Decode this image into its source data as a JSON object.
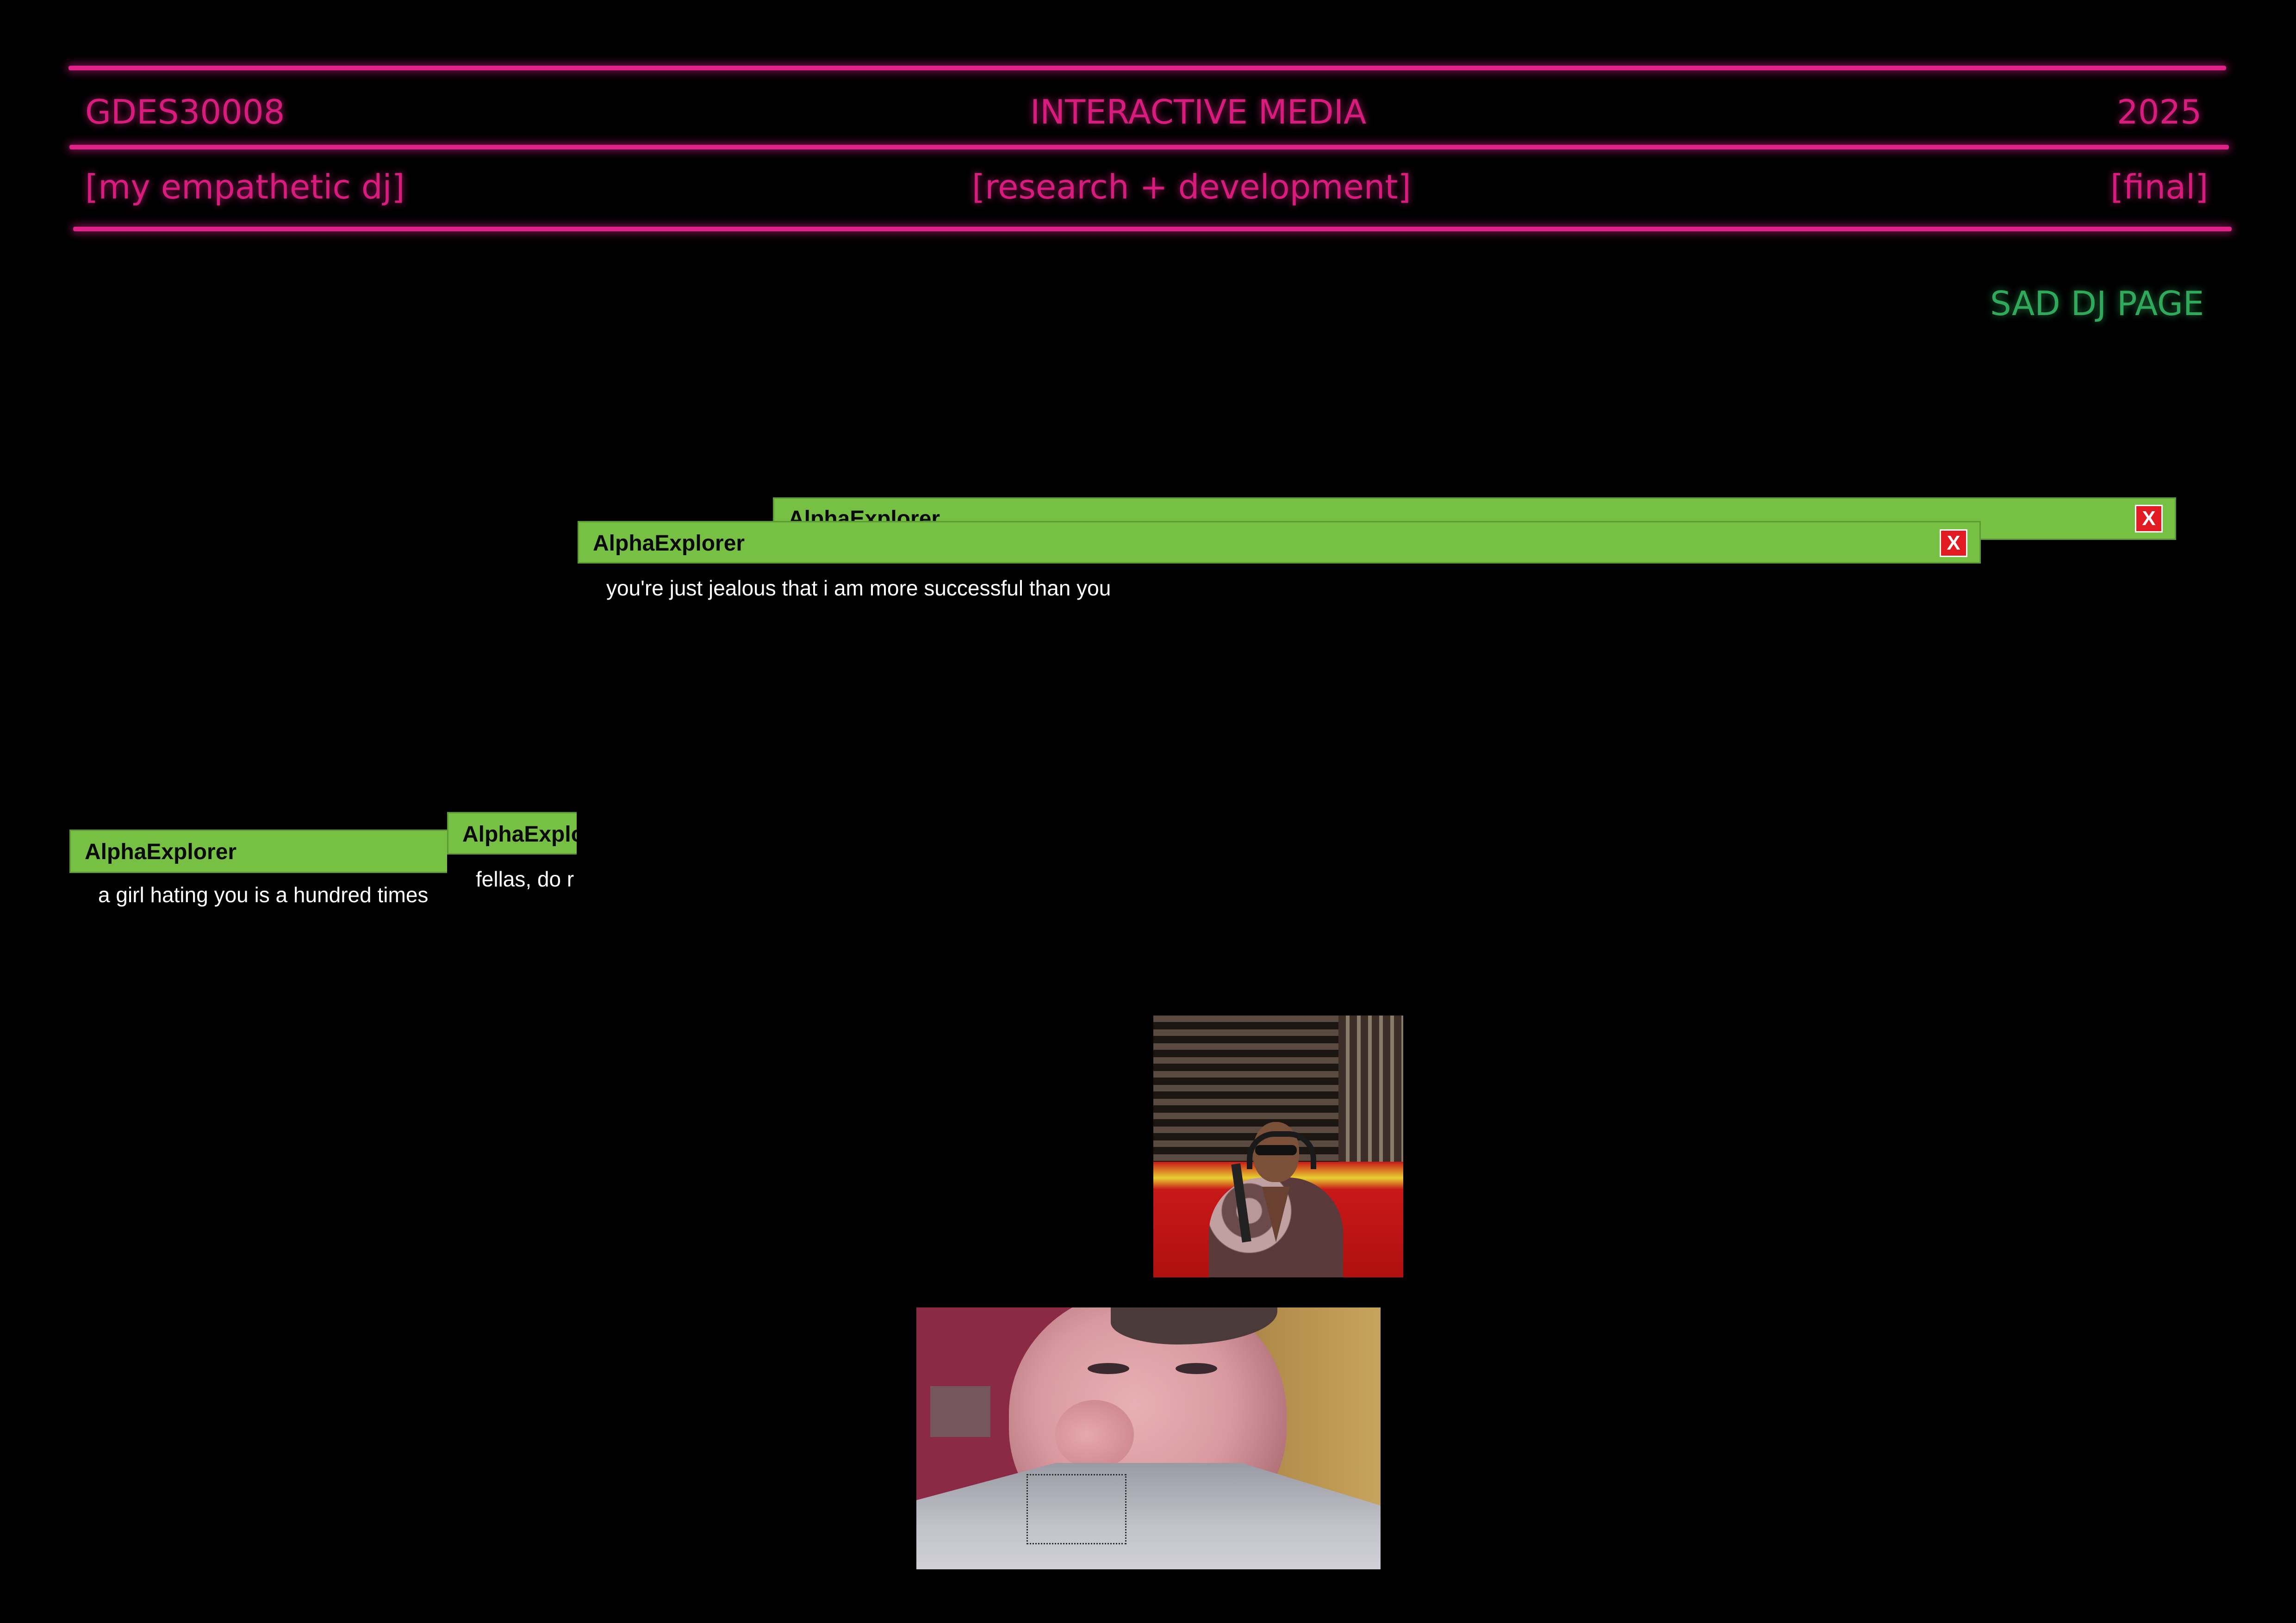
{
  "header": {
    "course_code": "GDES30008",
    "course_name": "INTERACTIVE MEDIA",
    "year": "2025",
    "project_name": "[my empathetic dj]",
    "section": "[research + development]",
    "status": "[final]"
  },
  "nav": {
    "sad_dj_link": "SAD DJ PAGE"
  },
  "popups": [
    {
      "title": "AlphaExplorer",
      "close_label": "X",
      "message": ""
    },
    {
      "title": "AlphaExplorer",
      "close_label": "X",
      "message": "you're just jealous that i am more successful than you"
    },
    {
      "title": "AlphaExplorer",
      "close_label": "",
      "message": "a girl hating you is a hundred times"
    },
    {
      "title": "AlphaExplorer",
      "close_label": "",
      "message": "fellas, do r"
    }
  ],
  "colors": {
    "accent_pink": "#e0218a",
    "link_green": "#2faa5c",
    "popup_bar": "#76c043",
    "close_red": "#e21b23",
    "background": "#000000"
  },
  "videos": [
    {
      "name": "studio-podcast-video"
    },
    {
      "name": "closeup-face-video"
    }
  ]
}
